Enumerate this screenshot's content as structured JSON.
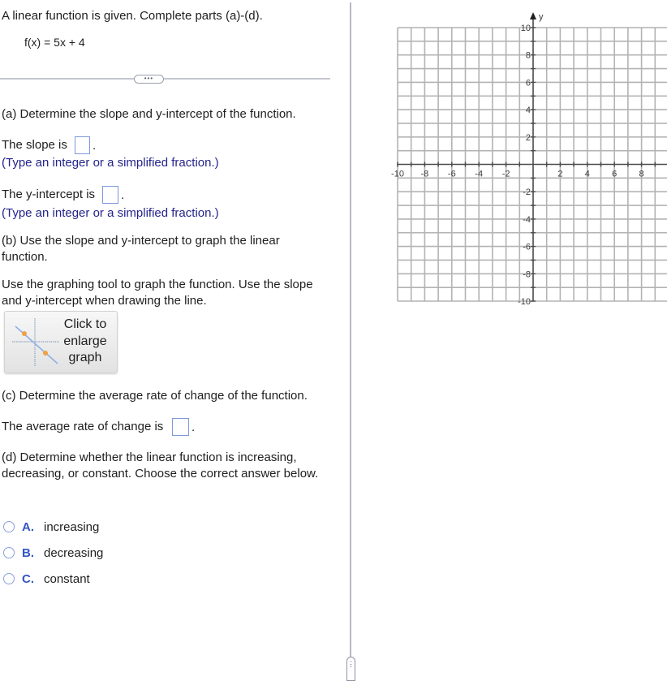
{
  "header": {
    "intro": "A linear function is given. Complete parts (a)-(d).",
    "function": "f(x) = 5x + 4"
  },
  "separator": {
    "more_button_label": "•••"
  },
  "part_a": {
    "heading": "(a) Determine the slope and y-intercept of the function.",
    "slope_prefix": "The slope is",
    "slope_value": "",
    "slope_hint": "(Type an integer or a simplified fraction.)",
    "intercept_prefix": "The y-intercept is",
    "intercept_value": "",
    "intercept_hint": "(Type an integer or a simplified fraction.)",
    "period": "."
  },
  "part_b": {
    "heading": "(b) Use the slope and y-intercept to graph the linear function.",
    "instruction": "Use the graphing tool to graph the function. Use the slope and y-intercept when drawing the line.",
    "enlarge_button_label": "Click to enlarge graph"
  },
  "part_c": {
    "heading": "(c) Determine the average rate of change of the function.",
    "rate_prefix": "The average rate of change is",
    "rate_value": "",
    "period": "."
  },
  "part_d": {
    "heading": "(d) Determine whether the linear function is increasing, decreasing, or constant. Choose the correct answer below.",
    "options": [
      {
        "letter": "A.",
        "text": "increasing",
        "selected": false
      },
      {
        "letter": "B.",
        "text": "decreasing",
        "selected": false
      },
      {
        "letter": "C.",
        "text": "constant",
        "selected": false
      }
    ]
  },
  "divider": {
    "handle_label": "⋮"
  },
  "graph": {
    "x_min": -10,
    "x_max": 10,
    "y_min": -10,
    "y_max": 10,
    "grid_step": 1,
    "x_tick_labels": [
      "-10",
      "-8",
      "-6",
      "-4",
      "-2",
      "2",
      "4",
      "6",
      "8"
    ],
    "y_tick_labels": [
      "10",
      "8",
      "6",
      "4",
      "2",
      "-2",
      "-4",
      "-6",
      "-8",
      "-10"
    ],
    "y_axis_label": "y",
    "grid_color": "#b3b3b3",
    "axis_color": "#4a4a4a"
  }
}
